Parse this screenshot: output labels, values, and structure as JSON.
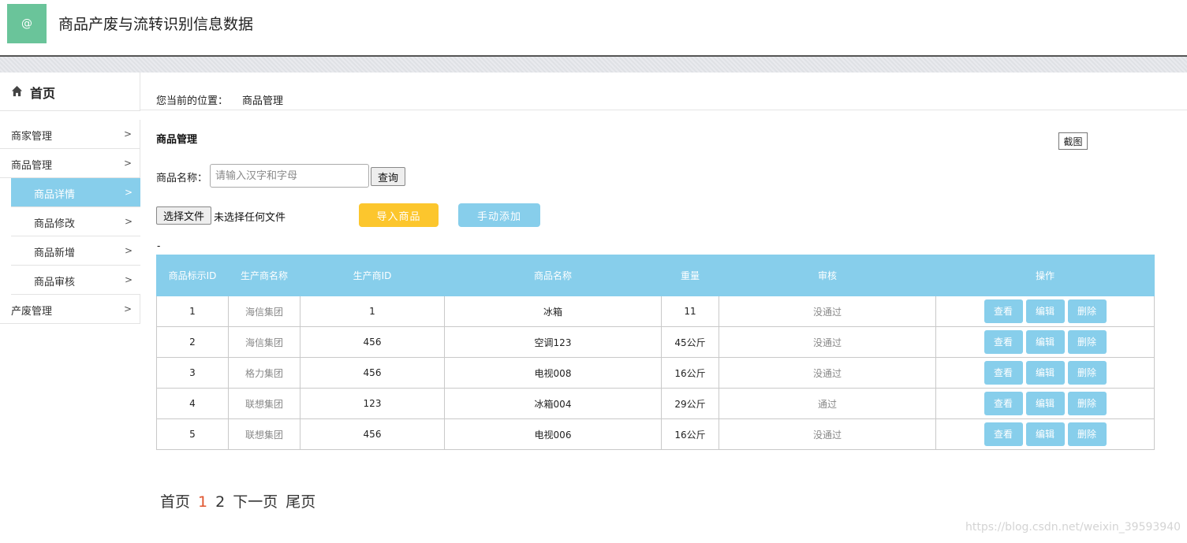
{
  "header": {
    "logo_text": "@",
    "title": "商品产废与流转识别信息数据",
    "logo_color": "#6ac49a"
  },
  "sidebar": {
    "home_label": "首页",
    "items": [
      {
        "label": "商家管理",
        "arrow": ">",
        "sub": false,
        "active": false
      },
      {
        "label": "商品管理",
        "arrow": ">",
        "sub": false,
        "active": false
      },
      {
        "label": "商品详情",
        "arrow": ">",
        "sub": true,
        "active": true
      },
      {
        "label": "商品修改",
        "arrow": ">",
        "sub": true,
        "active": false
      },
      {
        "label": "商品新增",
        "arrow": ">",
        "sub": true,
        "active": false
      },
      {
        "label": "商品审核",
        "arrow": ">",
        "sub": true,
        "active": false
      },
      {
        "label": "产废管理",
        "arrow": ">",
        "sub": false,
        "active": false
      }
    ]
  },
  "breadcrumb": {
    "prefix": "您当前的位置：",
    "current": "商品管理"
  },
  "section_title": "商品管理",
  "screenshot_button": "截图",
  "search": {
    "label": "商品名称：",
    "placeholder": "请输入汉字和字母",
    "value": "",
    "button": "查询"
  },
  "file": {
    "button": "选择文件",
    "status": "未选择任何文件"
  },
  "actions": {
    "import": "导入商品",
    "manual_add": "手动添加"
  },
  "dash": "-",
  "table": {
    "headers": [
      "商品标示ID",
      "生产商名称",
      "生产商ID",
      "商品名称",
      "重量",
      "审核",
      "操作"
    ],
    "rows": [
      {
        "id": "1",
        "maker": "海信集团",
        "maker_id": "1",
        "name": "冰箱",
        "weight": "11",
        "review": "没通过"
      },
      {
        "id": "2",
        "maker": "海信集团",
        "maker_id": "456",
        "name": "空调123",
        "weight": "45公斤",
        "review": "没通过"
      },
      {
        "id": "3",
        "maker": "格力集团",
        "maker_id": "456",
        "name": "电视008",
        "weight": "16公斤",
        "review": "没通过"
      },
      {
        "id": "4",
        "maker": "联想集团",
        "maker_id": "123",
        "name": "冰箱004",
        "weight": "29公斤",
        "review": "通过"
      },
      {
        "id": "5",
        "maker": "联想集团",
        "maker_id": "456",
        "name": "电视006",
        "weight": "16公斤",
        "review": "没通过"
      }
    ],
    "row_actions": {
      "view": "查看",
      "edit": "编辑",
      "delete": "删除"
    }
  },
  "pager": {
    "first": "首页",
    "page1": "1",
    "page2": "2",
    "next": "下一页",
    "last": "尾页"
  },
  "watermark": "https://blog.csdn.net/weixin_39593940",
  "colors": {
    "accent": "#87ceeb",
    "import": "#fcc62d",
    "current_page": "#e0542e"
  }
}
